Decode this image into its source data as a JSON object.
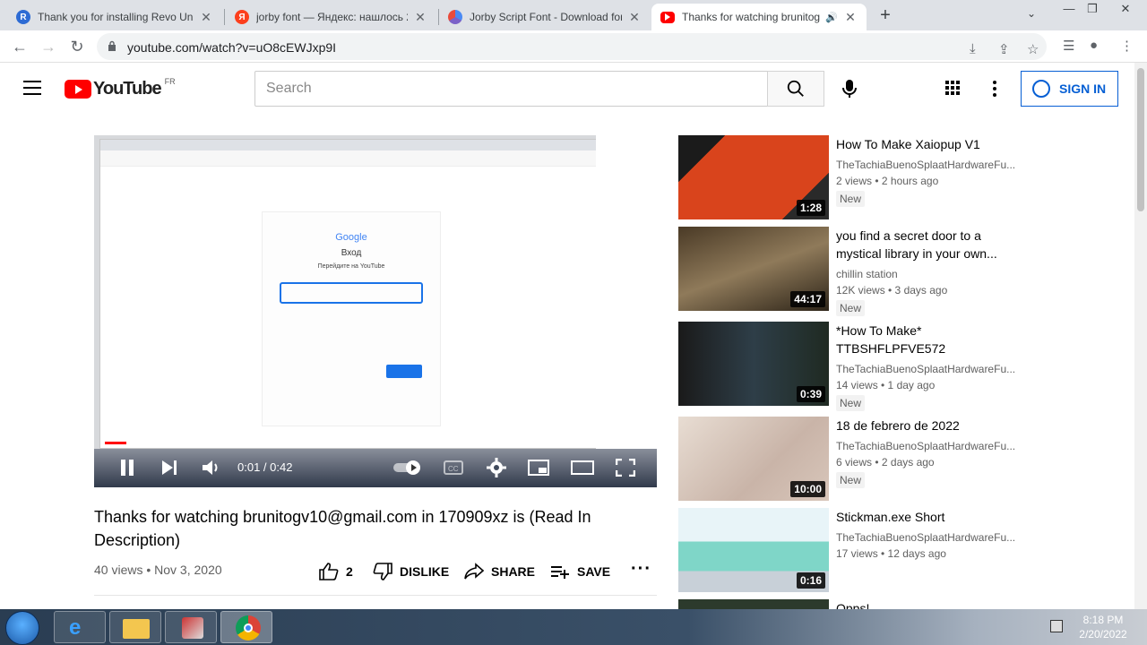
{
  "browser": {
    "tabs": [
      {
        "title": "Thank you for installing Revo Un",
        "favicon": "revo-icon",
        "color": "#2d6bd4"
      },
      {
        "title": "jorby font — Яндекс: нашлось 2",
        "favicon": "yandex-icon",
        "color": "#fc3f1d"
      },
      {
        "title": "Jorby Script Font - Download for",
        "favicon": "font-site-icon",
        "color": "#7b61c8"
      },
      {
        "title": "Thanks for watching brunitog",
        "favicon": "youtube-icon",
        "color": "#ff0000"
      }
    ],
    "url": "youtube.com/watch?v=uO8cEWJxp9I"
  },
  "youtube": {
    "logo_text": "YouTube",
    "country_code": "FR",
    "search_placeholder": "Search",
    "signin_label": "SIGN IN"
  },
  "player": {
    "time": "0:01 / 0:42",
    "progress": 0.04,
    "inner_google": "Google",
    "inner_heading": "Вход",
    "inner_sub": "Перейдите на YouTube"
  },
  "video": {
    "title": "Thanks for watching brunitogv10@gmail.com in 170909xz is (Read In Description)",
    "meta": "40 views • Nov 3, 2020",
    "likes": "2",
    "dislike": "DISLIKE",
    "share": "SHARE",
    "save": "SAVE"
  },
  "related": [
    {
      "title": "How To Make Xaiopup V1",
      "channel": "TheTachiaBuenoSplaatHardwareFu...",
      "views": "2 views • 2 hours ago",
      "badge": "New",
      "duration": "1:28"
    },
    {
      "title": "you find a secret door to a mystical library in your own...",
      "channel": "chillin station",
      "views": "12K views • 3 days ago",
      "badge": "New",
      "duration": "44:17"
    },
    {
      "title": "*How To Make* TTBSHFLPFVE572",
      "channel": "TheTachiaBuenoSplaatHardwareFu...",
      "views": "14 views • 1 day ago",
      "badge": "New",
      "duration": "0:39"
    },
    {
      "title": "18 de febrero de 2022",
      "channel": "TheTachiaBuenoSplaatHardwareFu...",
      "views": "6 views • 2 days ago",
      "badge": "New",
      "duration": "10:00"
    },
    {
      "title": "Stickman.exe Short",
      "channel": "TheTachiaBuenoSplaatHardwareFu...",
      "views": "17 views • 12 days ago",
      "badge": "",
      "duration": "0:16"
    },
    {
      "title": "Opps!",
      "channel": "",
      "views": "",
      "badge": "",
      "duration": ""
    }
  ],
  "taskbar": {
    "time": "8:18 PM",
    "date": "2/20/2022"
  }
}
